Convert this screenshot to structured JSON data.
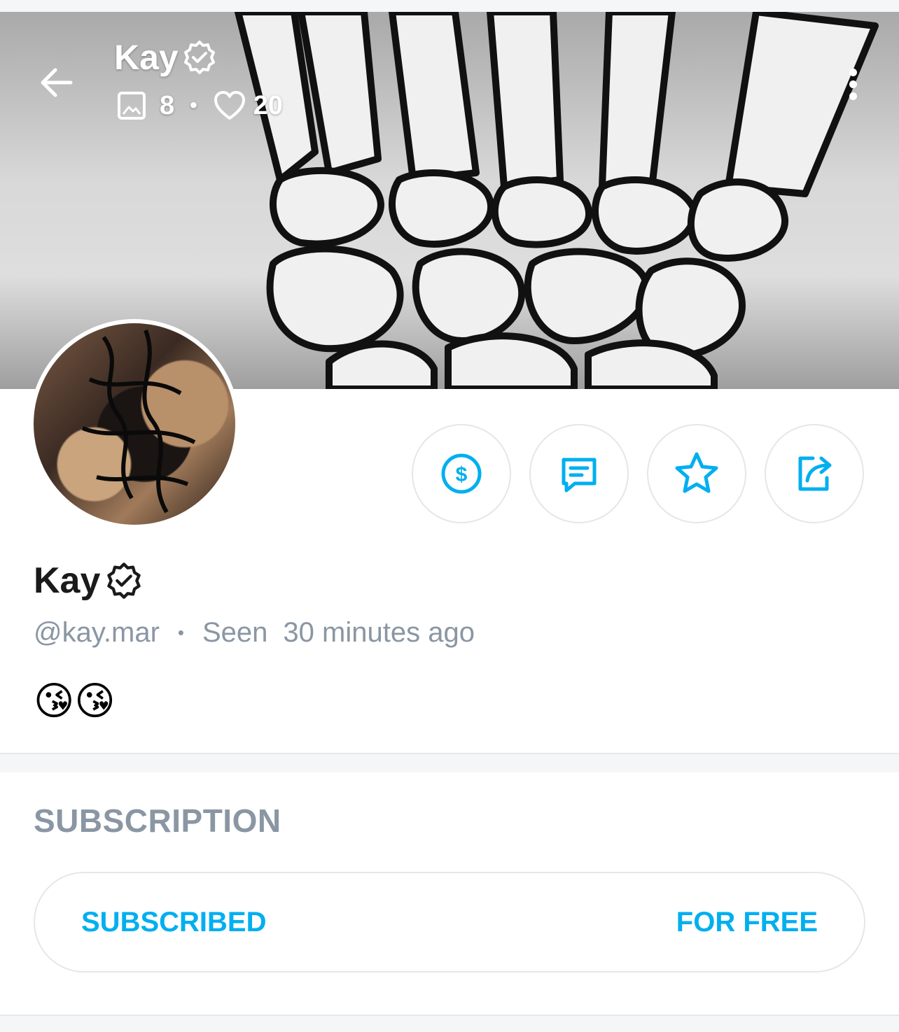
{
  "header": {
    "title": "Kay",
    "stats": {
      "media_count": "8",
      "likes_count": "20"
    }
  },
  "profile": {
    "name": "Kay",
    "username": "@kay.mar",
    "seen_label": "Seen",
    "seen_time": "30 minutes ago",
    "bio": "😘😘"
  },
  "actions": [
    "tip-icon",
    "message-icon",
    "star-icon",
    "share-icon"
  ],
  "subscription": {
    "section_title": "SUBSCRIPTION",
    "status_label": "SUBSCRIBED",
    "price_label": "FOR FREE"
  },
  "colors": {
    "accent": "#00aff0",
    "muted": "#8a96a3",
    "border": "#e3e7eb"
  }
}
